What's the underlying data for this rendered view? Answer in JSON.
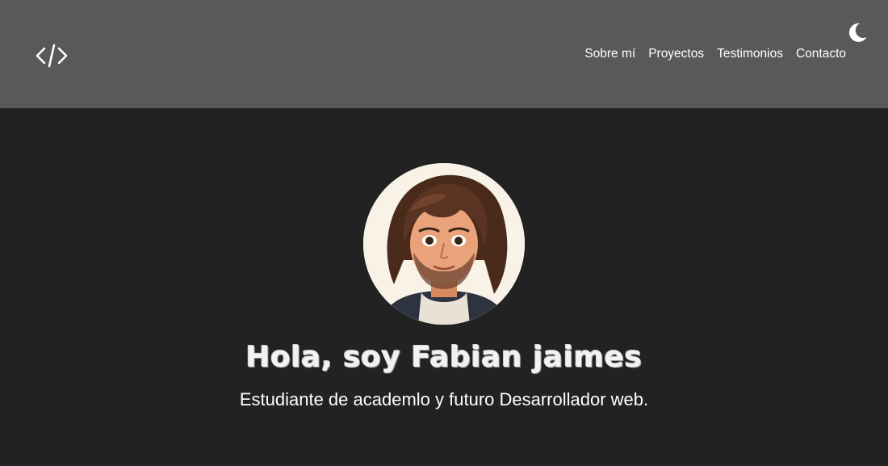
{
  "header": {
    "logo_icon": "code-brackets-icon",
    "nav": [
      {
        "label": "Sobre mí"
      },
      {
        "label": "Proyectos"
      },
      {
        "label": "Testimonios"
      },
      {
        "label": "Contacto"
      }
    ],
    "theme_toggle_icon": "moon-icon"
  },
  "hero": {
    "avatar_icon": "cartoon-portrait-avatar",
    "title": "Hola, soy Fabian jaimes",
    "subtitle": "Estudiante de academlo y futuro Desarrollador web."
  },
  "colors": {
    "header_bg": "#595959",
    "page_bg": "#222222",
    "text": "#ffffff"
  }
}
